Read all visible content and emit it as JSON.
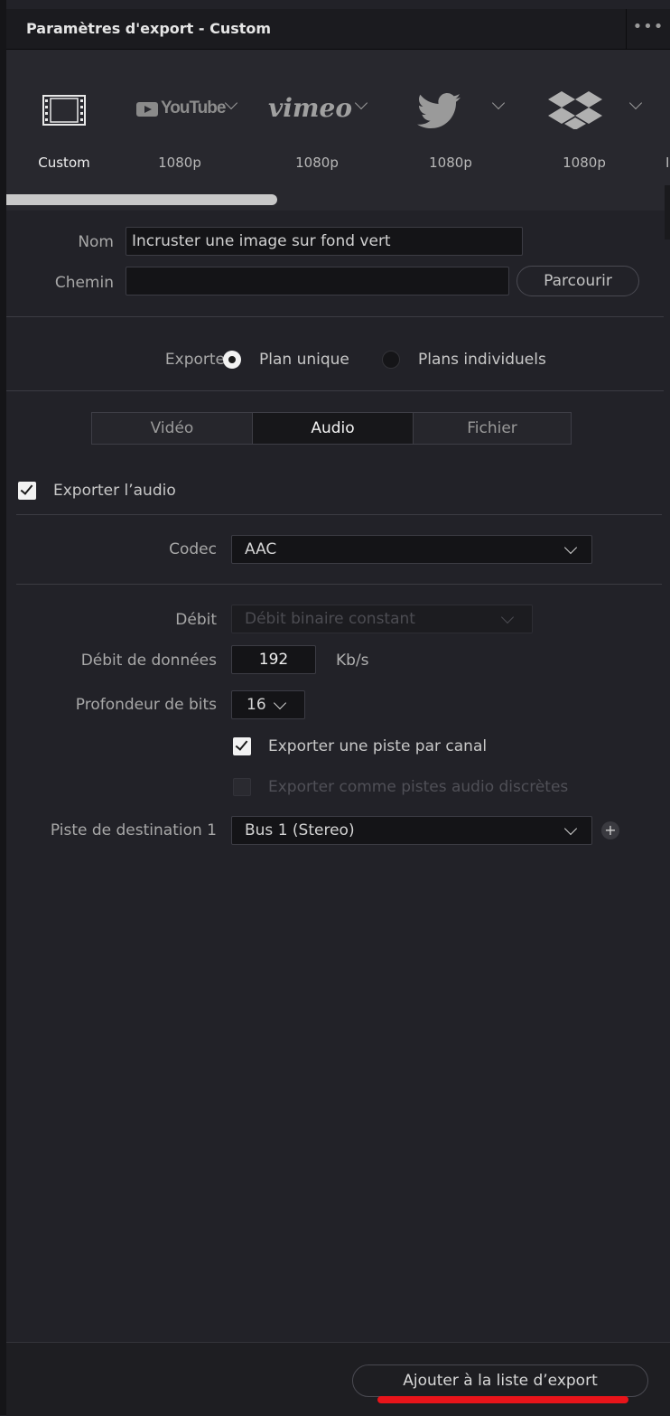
{
  "window": {
    "title": "Paramètres d'export - Custom",
    "more_label": "•••"
  },
  "presets": [
    {
      "name": "Custom",
      "label": "Custom"
    },
    {
      "name": "YouTube",
      "logo": "YouTube",
      "label": "1080p"
    },
    {
      "name": "Vimeo",
      "logo": "vimeo",
      "label": "1080p"
    },
    {
      "name": "Twitter",
      "label": "1080p"
    },
    {
      "name": "Dropbox",
      "label": "1080p"
    },
    {
      "name": "partial",
      "label": "I"
    }
  ],
  "fields": {
    "name_label": "Nom",
    "name_value": "Incruster une image sur fond vert",
    "path_label": "Chemin",
    "path_value": "",
    "browse_label": "Parcourir"
  },
  "export_mode": {
    "label": "Exporter",
    "options": [
      "Plan unique",
      "Plans individuels"
    ],
    "selected": "Plan unique"
  },
  "tabs": [
    "Vidéo",
    "Audio",
    "Fichier"
  ],
  "active_tab": "Audio",
  "audio": {
    "export_audio_label": "Exporter l’audio",
    "export_audio_checked": true,
    "codec_label": "Codec",
    "codec_value": "AAC",
    "bitrate_label": "Débit",
    "bitrate_value": "Débit binaire constant",
    "data_rate_label": "Débit de données",
    "data_rate_value": "192",
    "data_rate_unit": "Kb/s",
    "bit_depth_label": "Profondeur de bits",
    "bit_depth_value": "16",
    "per_channel_label": "Exporter une piste par canal",
    "per_channel_checked": true,
    "discrete_label": "Exporter comme pistes audio discrètes",
    "discrete_checked": false,
    "dest_track_label": "Piste de destination 1",
    "dest_track_value": "Bus 1 (Stereo)",
    "add_label": "+"
  },
  "footer": {
    "add_to_queue_label": "Ajouter à la liste d’export"
  },
  "colors": {
    "highlight": "#e8141a",
    "background": "#222228"
  }
}
